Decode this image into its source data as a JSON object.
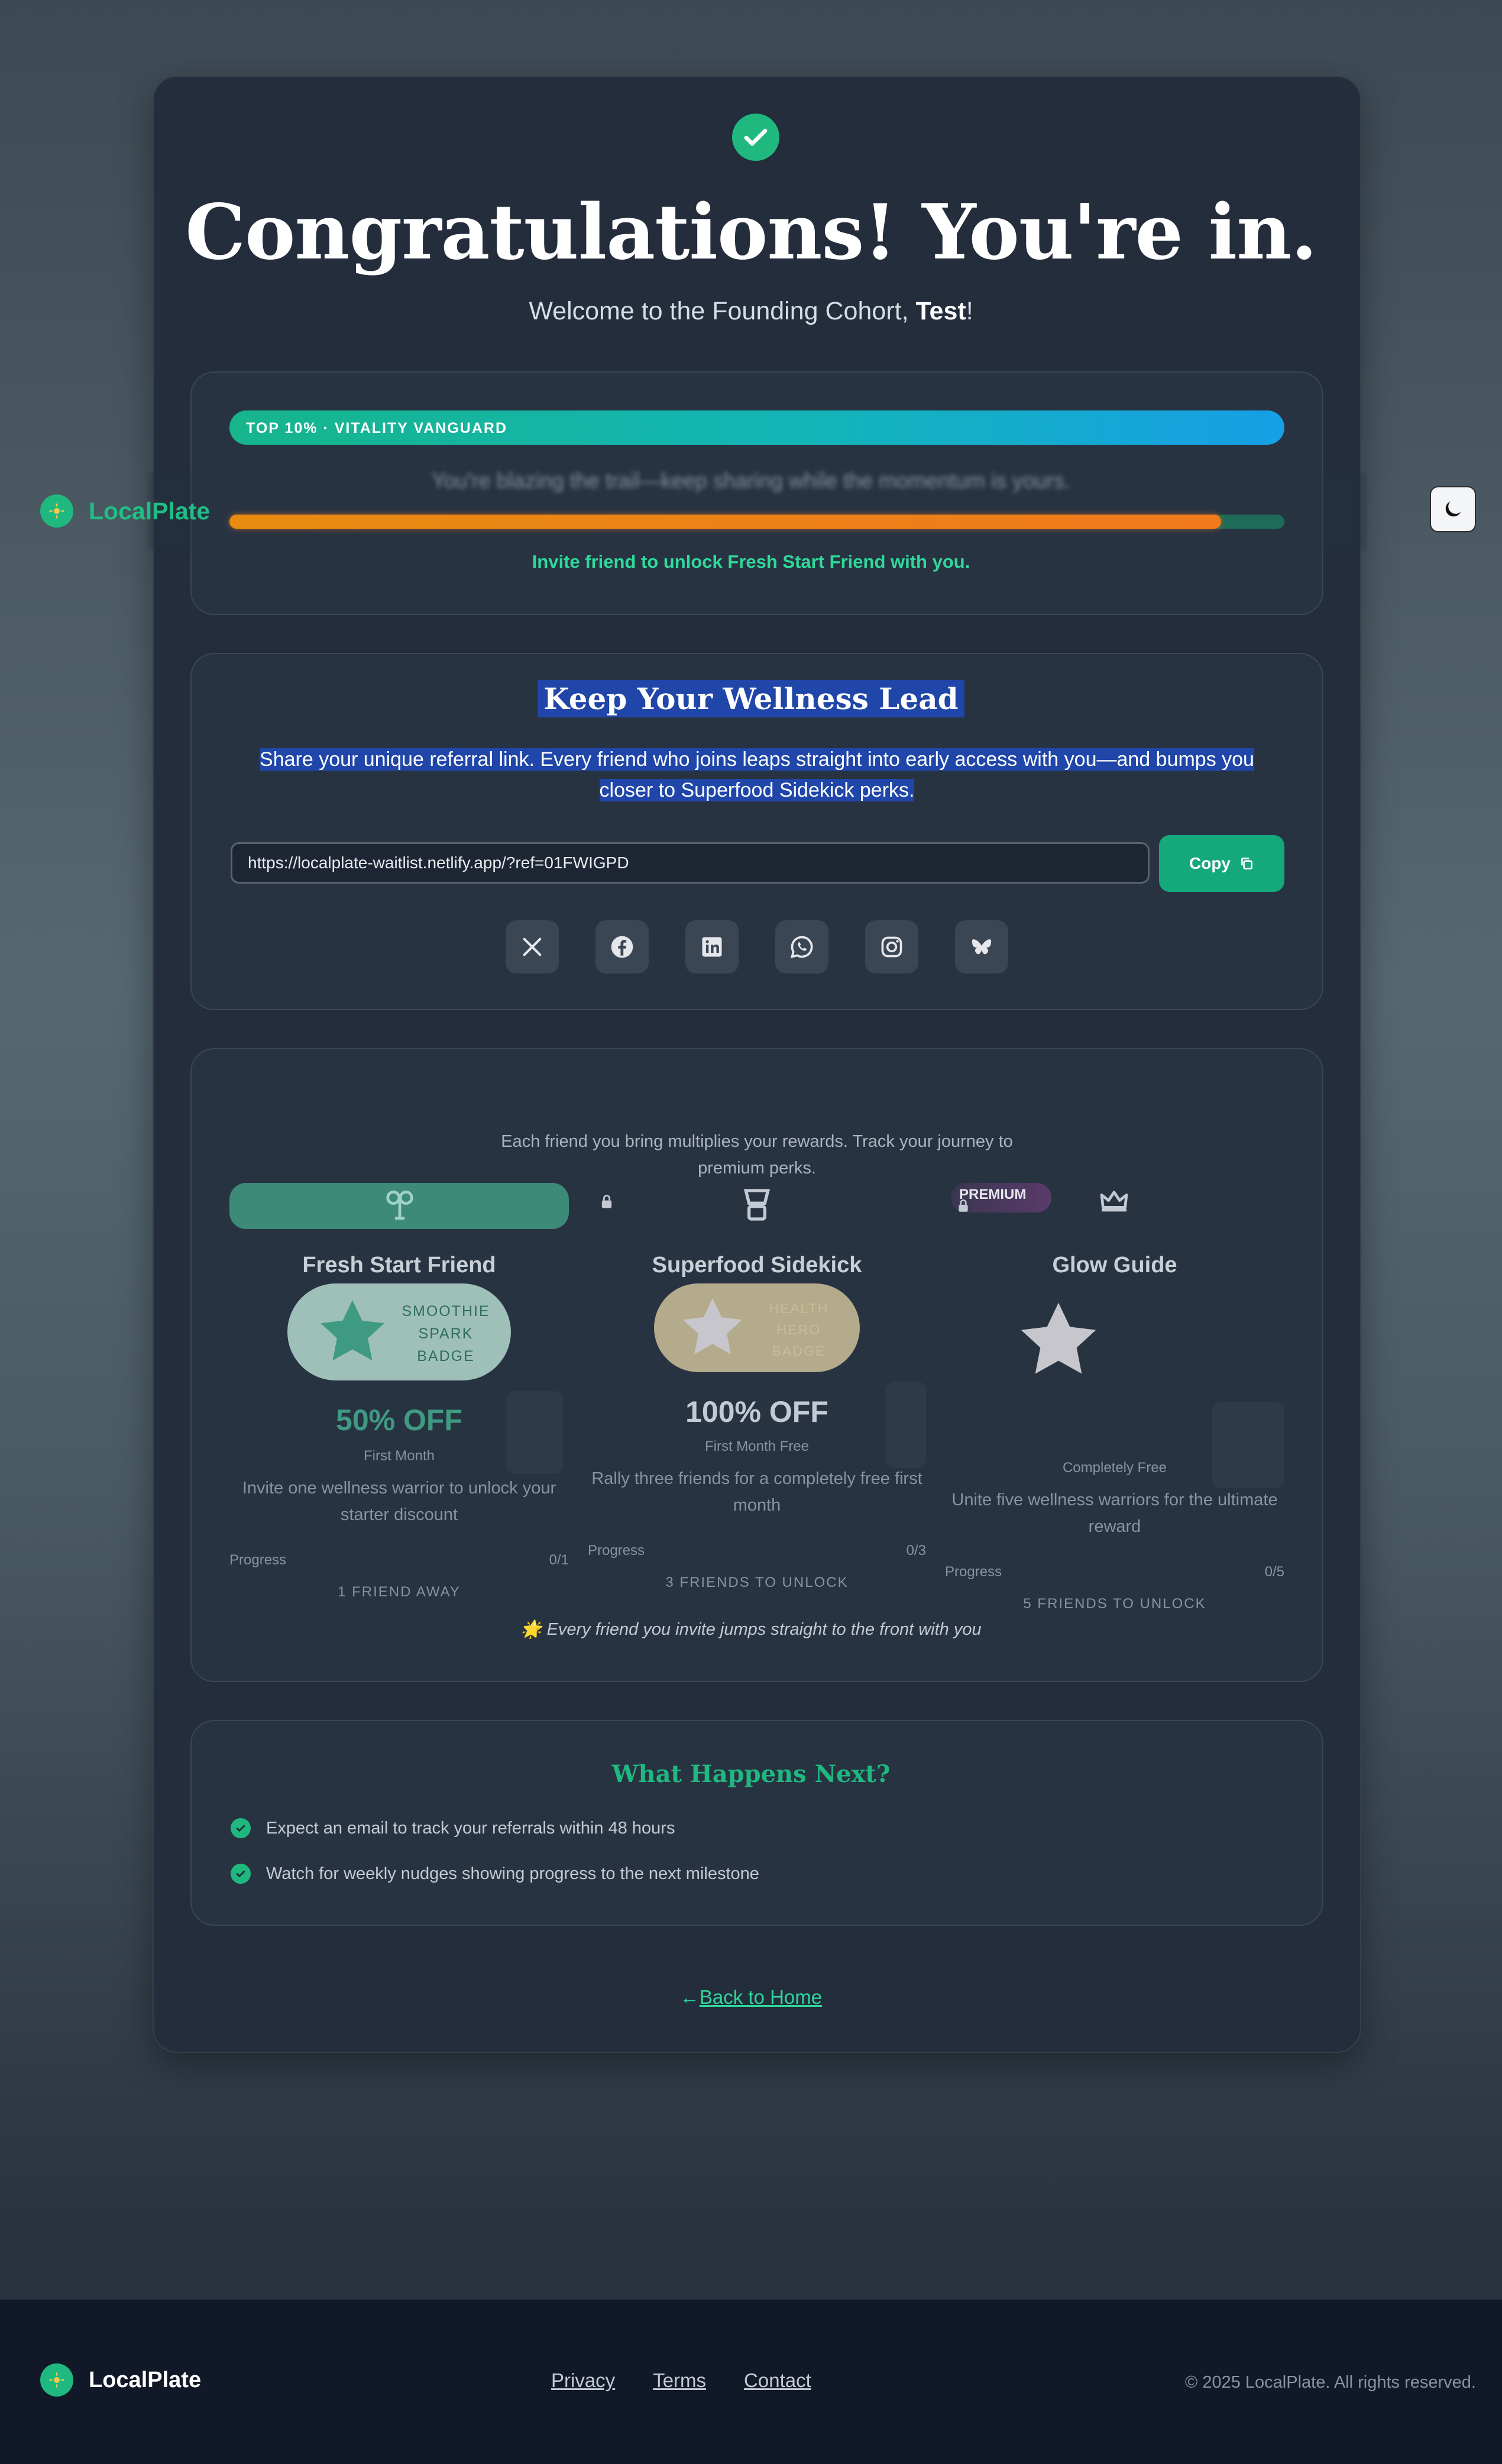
{
  "hero": {
    "title": "Congratulations! You're in.",
    "subtitle_prefix": "Welcome to the Founding Cohort, ",
    "user_name": "Test",
    "subtitle_suffix": "!"
  },
  "rank": {
    "badge_label": "TOP 10% · VITALITY VANGUARD",
    "message": "You're blazing the trail—keep sharing while the momentum is yours.",
    "progress_fraction": 0.94,
    "invite_text": "Invite friend to unlock Fresh Start Friend with you."
  },
  "header": {
    "logo_text": "LocalPlate",
    "theme_toggle_icon": "moon-icon"
  },
  "share": {
    "title": "Keep Your Wellness Lead",
    "description_line1": "Share your unique referral link. Every friend who joins leaps straight into early access with you—and bumps you",
    "description_line2": "closer to Superfood Sidekick perks.",
    "link_value": "https://localplate-waitlist.netlify.app/?ref=01FWIGPD",
    "copy_label": "Copy",
    "socials": [
      "x-icon",
      "facebook-icon",
      "linkedin-icon",
      "whatsapp-icon",
      "instagram-icon",
      "bluesky-icon"
    ]
  },
  "rewards": {
    "description": "Each friend you bring multiplies your rewards. Track your journey to premium perks.",
    "tiers": [
      {
        "name": "Fresh Start Friend",
        "badge_lines": [
          "SMOOTHIE",
          "SPARK",
          "BADGE"
        ],
        "discount": "50% OFF",
        "duration": "First Month",
        "description": "Invite one wellness warrior to unlock your starter discount",
        "progress_label": "Progress",
        "progress": "0/1",
        "unlock_label": "1 FRIEND AWAY"
      },
      {
        "name": "Superfood Sidekick",
        "badge_lines": [
          "HEALTH",
          "HERO",
          "BADGE"
        ],
        "discount": "100% OFF",
        "duration": "First Month Free",
        "description": "Rally three friends for a completely free first month",
        "progress_label": "Progress",
        "progress": "0/3",
        "unlock_label": "3 FRIENDS TO UNLOCK"
      },
      {
        "name": "Glow Guide",
        "tag": "PREMIUM",
        "duration": "Completely Free",
        "description": "Unite five wellness warriors for the ultimate reward",
        "progress_label": "Progress",
        "progress": "0/5",
        "unlock_label": "5 FRIENDS TO UNLOCK"
      }
    ],
    "footnote": "🌟 Every friend you invite jumps straight to the front with you"
  },
  "next": {
    "title": "What Happens Next?",
    "items": [
      "Expect an email to track your referrals within 48 hours",
      "Watch for weekly nudges showing progress to the next milestone"
    ]
  },
  "back_link": {
    "arrow": "←",
    "label": "Back to Home"
  },
  "footer": {
    "logo_text": "LocalPlate",
    "links": [
      "Privacy",
      "Terms",
      "Contact"
    ],
    "copyright": "© 2025 LocalPlate. All rights reserved."
  },
  "colors": {
    "accent": "#1fb980",
    "card": "#232d3b",
    "footer": "#111827",
    "orange": "#f07a1c"
  }
}
